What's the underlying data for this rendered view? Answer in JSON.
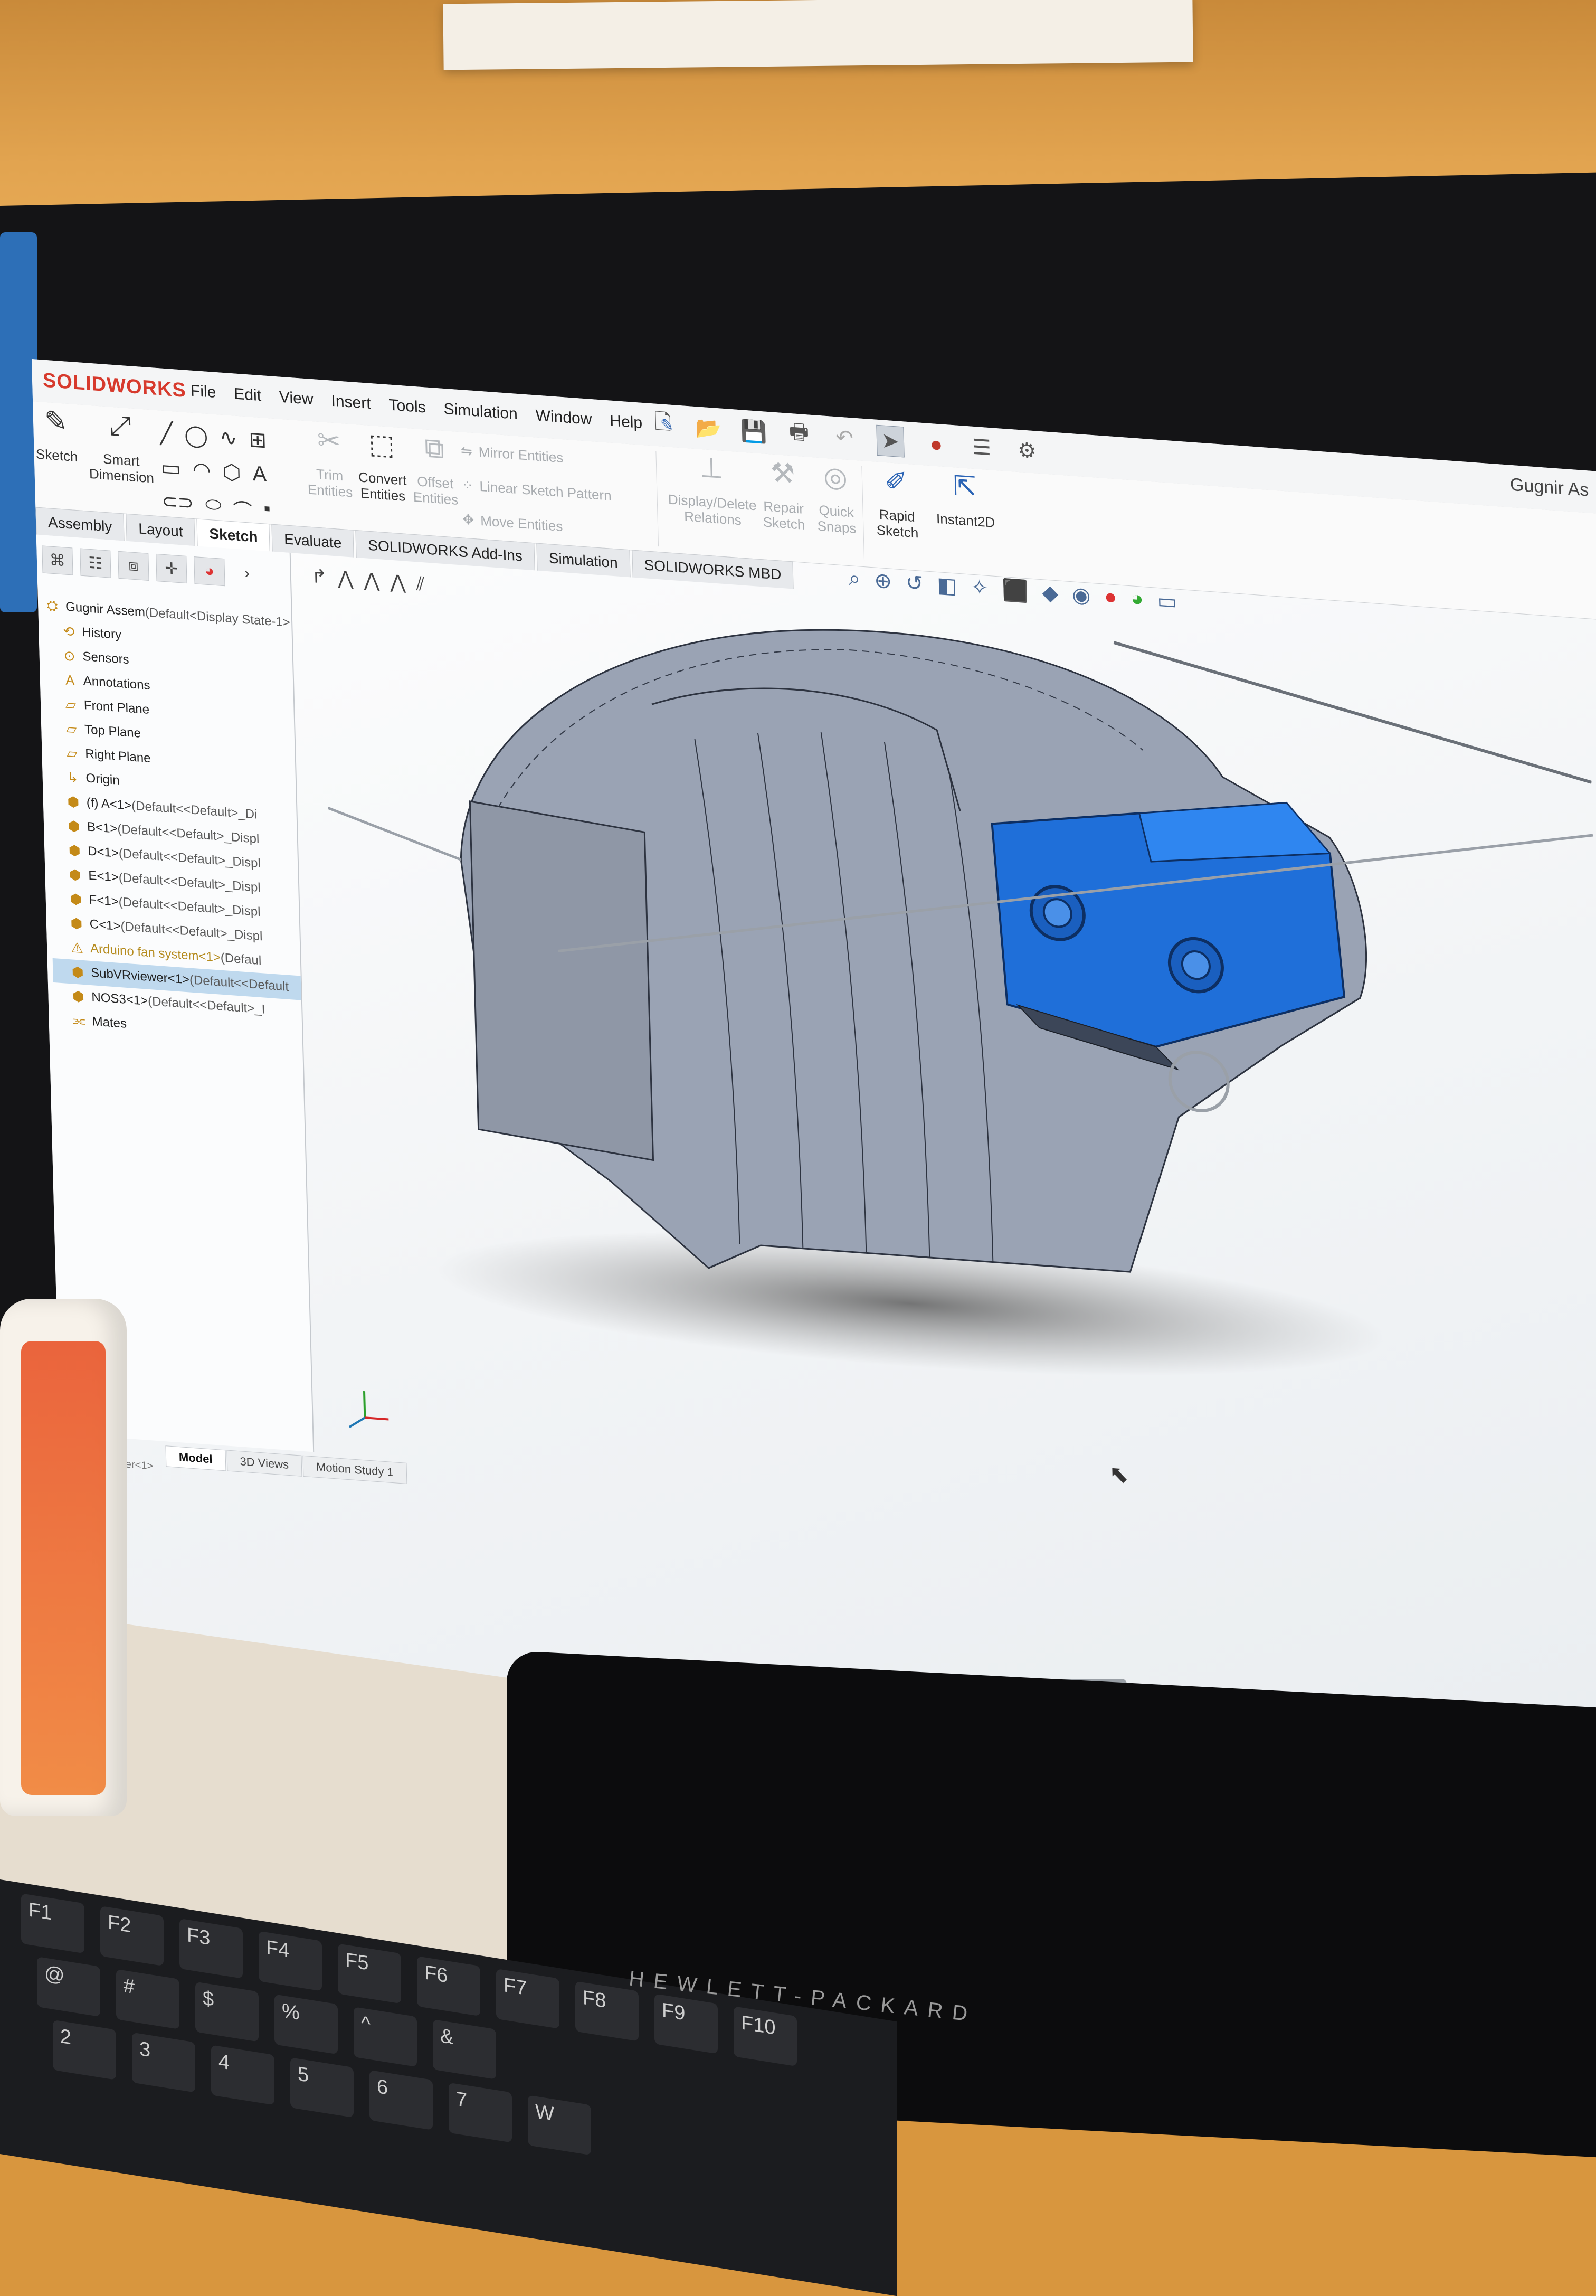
{
  "app": {
    "logo_text": "SOLIDWORKS",
    "doc_title": "Gugnir As"
  },
  "menu": [
    "File",
    "Edit",
    "View",
    "Insert",
    "Tools",
    "Simulation",
    "Window",
    "Help"
  ],
  "quick_access_icons": [
    "new-icon",
    "open-icon",
    "save-icon",
    "print-icon",
    "undo-icon",
    "select-icon",
    "rebuild-icon",
    "file-properties-icon",
    "options-icon"
  ],
  "ribbon": {
    "sketch": "Sketch",
    "smart_dimension": "Smart Dimension",
    "trim_entities": "Trim Entities",
    "convert_entities": "Convert Entities",
    "offset_entities": "Offset Entities",
    "mirror_entities": "Mirror Entities",
    "linear_sketch_pattern": "Linear Sketch Pattern",
    "move_entities": "Move Entities",
    "display_delete_relations": "Display/Delete Relations",
    "repair_sketch": "Repair Sketch",
    "quick_snaps": "Quick Snaps",
    "rapid_sketch": "Rapid Sketch",
    "instant2d": "Instant2D"
  },
  "command_tabs": [
    {
      "label": "Assembly",
      "active": false
    },
    {
      "label": "Layout",
      "active": false
    },
    {
      "label": "Sketch",
      "active": true
    },
    {
      "label": "Evaluate",
      "active": false
    },
    {
      "label": "SOLIDWORKS Add-Ins",
      "active": false
    },
    {
      "label": "Simulation",
      "active": false
    },
    {
      "label": "SOLIDWORKS MBD",
      "active": false
    }
  ],
  "tree": [
    {
      "label": "Gugnir Assem",
      "suffix": " (Default<Display State-1>",
      "icon": "assembly-icon",
      "level": 0
    },
    {
      "label": "History",
      "suffix": "",
      "icon": "history-icon",
      "level": 1
    },
    {
      "label": "Sensors",
      "suffix": "",
      "icon": "sensors-icon",
      "level": 1
    },
    {
      "label": "Annotations",
      "suffix": "",
      "icon": "annotations-icon",
      "level": 1
    },
    {
      "label": "Front Plane",
      "suffix": "",
      "icon": "plane-icon",
      "level": 1
    },
    {
      "label": "Top Plane",
      "suffix": "",
      "icon": "plane-icon",
      "level": 1
    },
    {
      "label": "Right Plane",
      "suffix": "",
      "icon": "plane-icon",
      "level": 1
    },
    {
      "label": "Origin",
      "suffix": "",
      "icon": "origin-icon",
      "level": 1
    },
    {
      "label": "(f) A<1>",
      "suffix": " (Default<<Default>_Di",
      "icon": "part-icon",
      "level": 1
    },
    {
      "label": "B<1>",
      "suffix": " (Default<<Default>_Displ",
      "icon": "part-icon",
      "level": 1
    },
    {
      "label": "D<1>",
      "suffix": " (Default<<Default>_Displ",
      "icon": "part-icon",
      "level": 1
    },
    {
      "label": "E<1>",
      "suffix": " (Default<<Default>_Displ",
      "icon": "part-icon",
      "level": 1
    },
    {
      "label": "F<1>",
      "suffix": " (Default<<Default>_Displ",
      "icon": "part-icon",
      "level": 1
    },
    {
      "label": "C<1>",
      "suffix": " (Default<<Default>_Displ",
      "icon": "part-icon",
      "level": 1
    },
    {
      "label": "Arduino fan system<1>",
      "suffix": " (Defaul",
      "icon": "warning-icon",
      "level": 1,
      "warn": true
    },
    {
      "label": "SubVRviewer<1>",
      "suffix": " (Default<<Default",
      "icon": "subassembly-icon",
      "level": 1,
      "selected": true
    },
    {
      "label": "NOS3<1>",
      "suffix": " (Default<<Default>_I",
      "icon": "part-icon",
      "level": 1
    },
    {
      "label": "Mates",
      "suffix": "",
      "icon": "mates-icon",
      "level": 1
    }
  ],
  "bottom_tabs": [
    {
      "label": "Model",
      "active": true
    },
    {
      "label": "3D Views",
      "active": false
    },
    {
      "label": "Motion Study 1",
      "active": false
    }
  ],
  "status": {
    "text": "SubVRviewer<1>"
  },
  "keyboard": {
    "brand": "HEWLETT-PACKARD",
    "keys": [
      "F1",
      "F2",
      "F3",
      "F4",
      "F5",
      "F6",
      "F7",
      "F8",
      "F9",
      "F10",
      "@",
      "#",
      "$",
      "%",
      "^",
      "&",
      "2",
      "3",
      "4",
      "5",
      "6",
      "7",
      "W"
    ]
  },
  "colors": {
    "solidworks_red": "#d73a2d",
    "model_gray": "#9aa3b4",
    "model_blue": "#1f6fd9",
    "selection_blue": "#bfd9ee"
  }
}
